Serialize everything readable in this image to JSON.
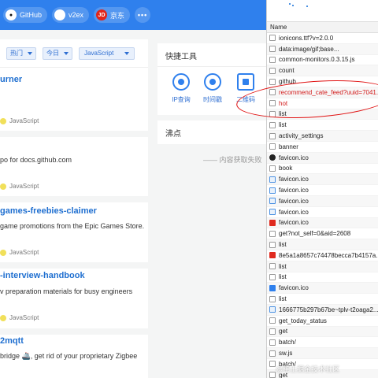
{
  "topbar": {
    "links": [
      {
        "label": "GitHub",
        "icon": "github-icon"
      },
      {
        "label": "v2ex",
        "icon": "v2ex-icon"
      },
      {
        "label": "京东",
        "icon": "jd-icon",
        "icon_text": "JD"
      }
    ],
    "more_label": "•••",
    "color": "#2f80ed"
  },
  "filters": {
    "sort": "热门",
    "period": "今日",
    "language": "JavaScript"
  },
  "repos": [
    {
      "title": "urner",
      "desc": "",
      "lang": "JavaScript"
    },
    {
      "title": "",
      "desc": "po for docs.github.com",
      "lang": "JavaScript"
    },
    {
      "title": "games-freebies-claimer",
      "desc": "game promotions from the Epic Games Store.",
      "lang": "JavaScript"
    },
    {
      "title": "-interview-handbook",
      "desc": "v preparation materials for busy engineers",
      "lang": "JavaScript"
    },
    {
      "title": "2mqtt",
      "desc": "bridge 🚢, get rid of your proprietary Zigbee",
      "lang": ""
    }
  ],
  "tools": {
    "title": "快捷工具",
    "items": [
      "IP查询",
      "时间戳",
      "二维码"
    ]
  },
  "hot": {
    "title": "沸点",
    "loading_text": "—— 内容获取失败"
  },
  "network": {
    "column_header": "Name",
    "rows": [
      {
        "name": "ionicons.ttf?v=2.0.0",
        "icon": "font-icon",
        "error": false
      },
      {
        "name": "data:image/gif;base...",
        "icon": "file-icon",
        "error": false
      },
      {
        "name": "common-monitors.0.3.15.js",
        "icon": "file-icon",
        "error": false
      },
      {
        "name": "count",
        "icon": "file-icon",
        "error": false
      },
      {
        "name": "github",
        "icon": "file-icon",
        "error": false
      },
      {
        "name": "recommend_cate_feed?uuid=7041...",
        "icon": "file-icon",
        "error": true
      },
      {
        "name": "hot",
        "icon": "file-icon",
        "error": true
      },
      {
        "name": "list",
        "icon": "file-icon",
        "error": false
      },
      {
        "name": "list",
        "icon": "file-icon",
        "error": false
      },
      {
        "name": "activity_settings",
        "icon": "file-icon",
        "error": false
      },
      {
        "name": "banner",
        "icon": "file-icon",
        "error": false
      },
      {
        "name": "favicon.ico",
        "icon": "github-favicon-icon",
        "error": false
      },
      {
        "name": "book",
        "icon": "file-icon",
        "error": false
      },
      {
        "name": "favicon.ico",
        "icon": "image-icon",
        "error": false
      },
      {
        "name": "favicon.ico",
        "icon": "image-icon",
        "error": false
      },
      {
        "name": "favicon.ico",
        "icon": "image-icon",
        "error": false
      },
      {
        "name": "favicon.ico",
        "icon": "image-icon",
        "error": false
      },
      {
        "name": "favicon.ico",
        "icon": "jd-favicon-icon",
        "error": false
      },
      {
        "name": "get?not_self=0&aid=2608",
        "icon": "file-icon",
        "error": false
      },
      {
        "name": "list",
        "icon": "file-icon",
        "error": false
      },
      {
        "name": "8e5a1a8657c74478becca7b4157a...",
        "icon": "red-image-icon",
        "error": false
      },
      {
        "name": "list",
        "icon": "file-icon",
        "error": false
      },
      {
        "name": "list",
        "icon": "file-icon",
        "error": false
      },
      {
        "name": "favicon.ico",
        "icon": "blue-image-icon",
        "error": false
      },
      {
        "name": "list",
        "icon": "file-icon",
        "error": false
      },
      {
        "name": "1666775b297b67be~tplv-t2oaga2...",
        "icon": "image-icon",
        "error": false
      },
      {
        "name": "get_today_status",
        "icon": "file-icon",
        "error": false
      },
      {
        "name": "get",
        "icon": "file-icon",
        "error": false
      },
      {
        "name": "batch/",
        "icon": "file-icon",
        "error": false
      },
      {
        "name": "sw.js",
        "icon": "gear-icon",
        "error": false
      },
      {
        "name": "batch/",
        "icon": "file-icon",
        "error": false
      },
      {
        "name": "get",
        "icon": "file-icon",
        "error": false
      }
    ]
  },
  "watermark": "@稀土掘金技术社区"
}
